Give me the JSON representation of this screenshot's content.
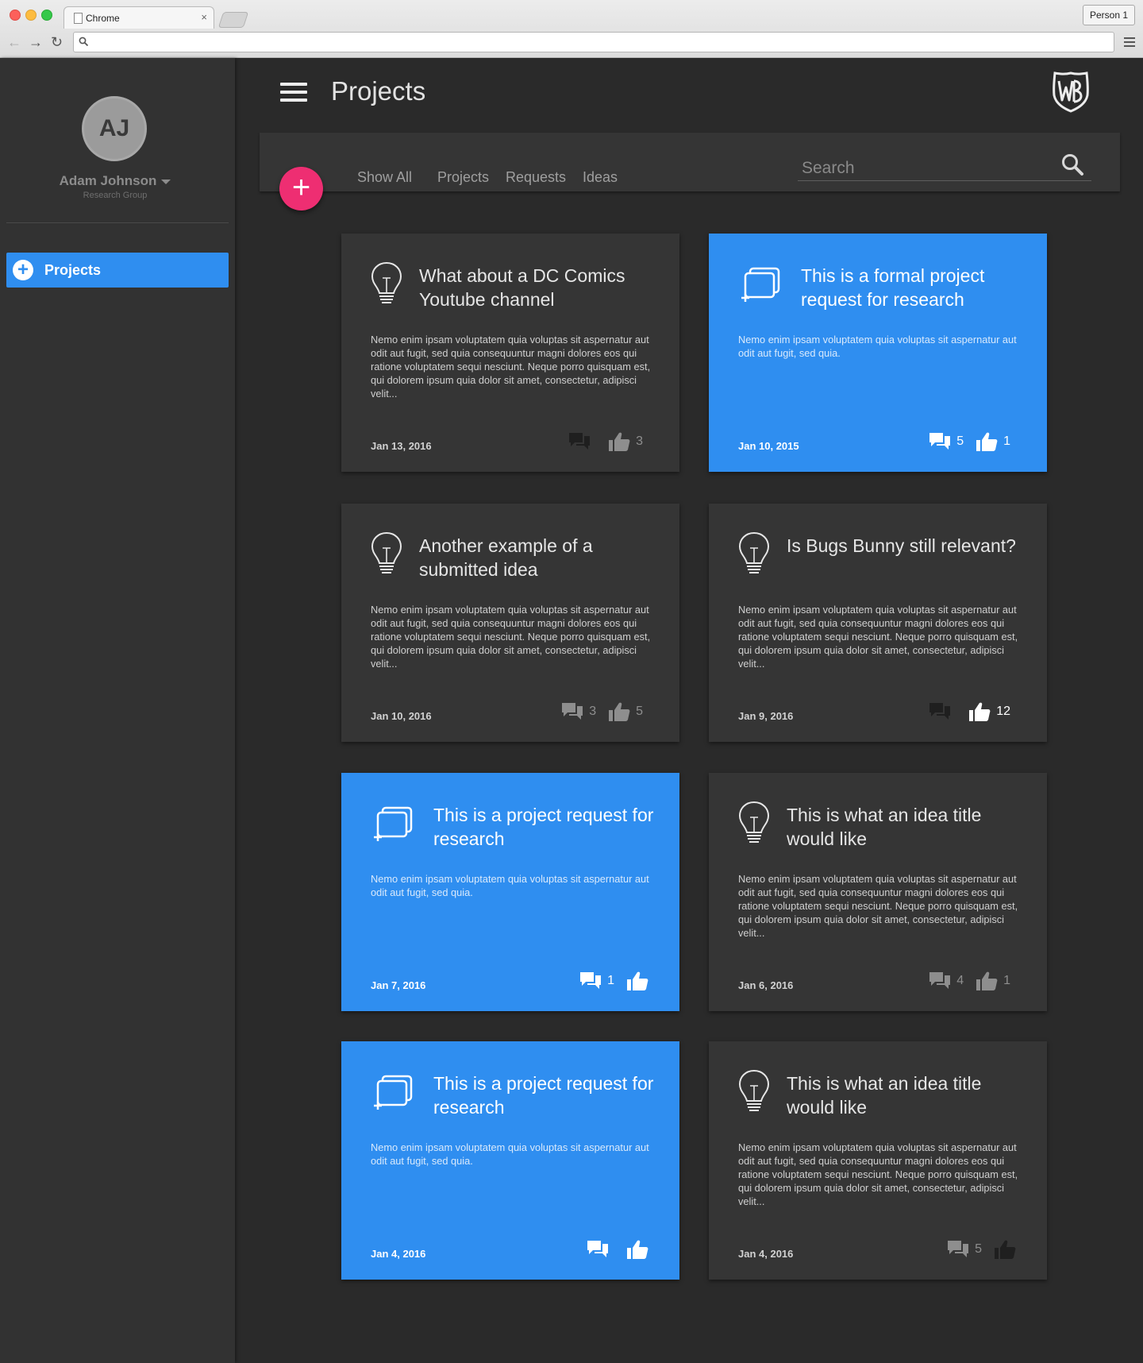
{
  "browser": {
    "tab_title": "Chrome",
    "tab_close": "×",
    "profile_label": "Person 1"
  },
  "sidebar": {
    "avatar_initials": "AJ",
    "user_name": "Adam Johnson",
    "user_group": "Research Group",
    "items": [
      {
        "label": "Projects",
        "icon": "plus-circle-icon"
      }
    ]
  },
  "header": {
    "title": "Projects",
    "logo": "wb-shield-logo"
  },
  "toolbar": {
    "add_label": "+",
    "filters": [
      "Show All",
      "Projects",
      "Requests",
      "Ideas"
    ],
    "search_placeholder": "Search"
  },
  "colors": {
    "accent_blue": "#2f8ef0",
    "fab_pink": "#ee2e72",
    "card_dark": "#353535",
    "background": "#2a2a2a"
  },
  "cards": [
    {
      "type": "idea",
      "icon": "lightbulb-icon",
      "title": "What about a DC Comics Youtube channel",
      "body": "Nemo enim ipsam voluptatem quia voluptas sit aspernatur aut odit aut fugit, sed quia consequuntur magni dolores eos qui ratione voluptatem sequi nesciunt. Neque porro quisquam est, qui dolorem ipsum quia dolor sit amet, consectetur, adipisci velit...",
      "date": "Jan 13, 2016",
      "comments": "",
      "likes": "3"
    },
    {
      "type": "request",
      "icon": "project-request-icon",
      "title": "This is a formal project request for research",
      "body": "Nemo enim ipsam voluptatem quia voluptas sit aspernatur aut odit aut fugit, sed quia.",
      "date": "Jan 10, 2015",
      "comments": "5",
      "likes": "1"
    },
    {
      "type": "idea",
      "icon": "lightbulb-icon",
      "title": "Another example of a submitted idea",
      "body": "Nemo enim ipsam voluptatem quia voluptas sit aspernatur aut odit aut fugit, sed quia consequuntur magni dolores eos qui ratione voluptatem sequi nesciunt. Neque porro quisquam est, qui dolorem ipsum quia dolor sit amet, consectetur, adipisci velit...",
      "date": "Jan 10, 2016",
      "comments": "3",
      "likes": "5"
    },
    {
      "type": "idea",
      "icon": "lightbulb-icon",
      "title": "Is Bugs Bunny still relevant?",
      "body": "Nemo enim ipsam voluptatem quia voluptas sit aspernatur aut odit aut fugit, sed quia consequuntur magni dolores eos qui ratione voluptatem sequi nesciunt. Neque porro quisquam est, qui dolorem ipsum quia dolor sit amet, consectetur, adipisci velit...",
      "date": "Jan 9, 2016",
      "comments": "",
      "likes": "12"
    },
    {
      "type": "request",
      "icon": "project-request-icon",
      "title": "This is a project request for research",
      "body": "Nemo enim ipsam voluptatem quia voluptas sit aspernatur aut odit aut fugit, sed quia.",
      "date": "Jan 7, 2016",
      "comments": "1",
      "likes": ""
    },
    {
      "type": "idea",
      "icon": "lightbulb-icon",
      "title": "This is what an idea title would like",
      "body": "Nemo enim ipsam voluptatem quia voluptas sit aspernatur aut odit aut fugit, sed quia consequuntur magni dolores eos qui ratione voluptatem sequi nesciunt. Neque porro quisquam est, qui dolorem ipsum quia dolor sit amet, consectetur, adipisci velit...",
      "date": "Jan 6, 2016",
      "comments": "4",
      "likes": "1"
    },
    {
      "type": "request",
      "icon": "project-request-icon",
      "title": "This is a project request for research",
      "body": "Nemo enim ipsam voluptatem quia voluptas sit aspernatur aut odit aut fugit, sed quia.",
      "date": "Jan 4, 2016",
      "comments": "",
      "likes": ""
    },
    {
      "type": "idea",
      "icon": "lightbulb-icon",
      "title": "This is what an idea title would like",
      "body": "Nemo enim ipsam voluptatem quia voluptas sit aspernatur aut odit aut fugit, sed quia consequuntur magni dolores eos qui ratione voluptatem sequi nesciunt. Neque porro quisquam est, qui dolorem ipsum quia dolor sit amet, consectetur, adipisci velit...",
      "date": "Jan 4, 2016",
      "comments": "5",
      "likes": ""
    }
  ]
}
